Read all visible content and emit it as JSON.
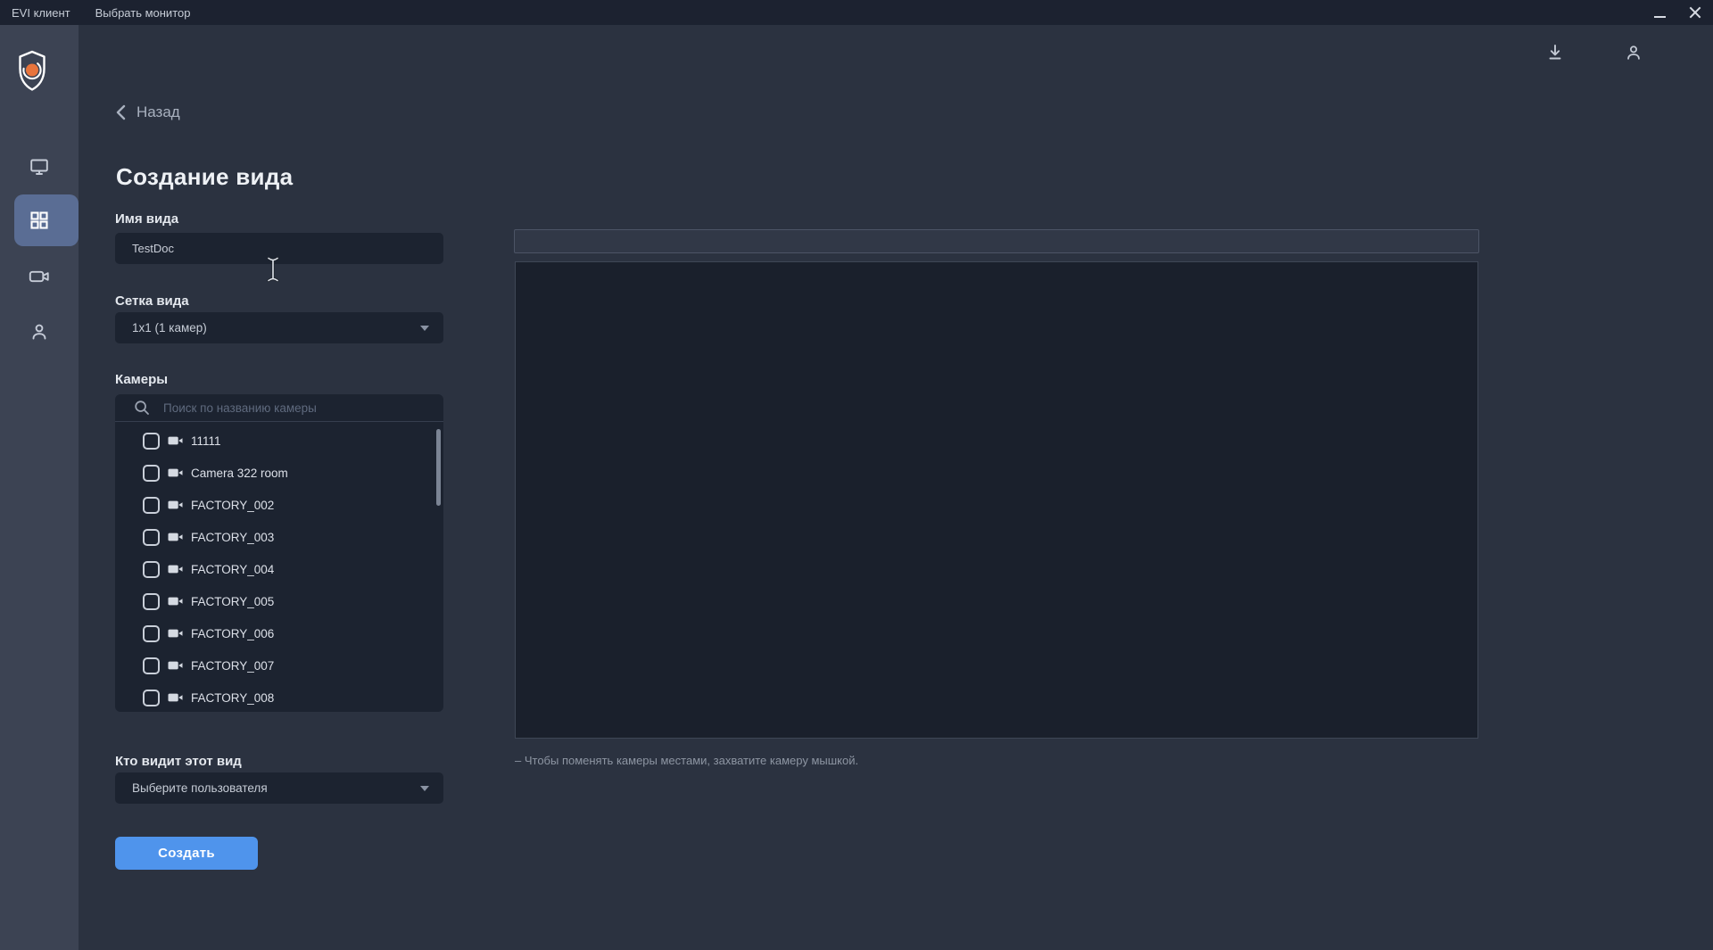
{
  "titlebar": {
    "app_menu": "EVI клиент",
    "monitor_menu": "Выбрать монитор"
  },
  "window_controls": {
    "minimize": "minimize",
    "close": "close"
  },
  "sidebar": {
    "items": [
      {
        "id": "monitors",
        "icon": "monitor-icon",
        "selected": false
      },
      {
        "id": "views",
        "icon": "grid-icon",
        "selected": true
      },
      {
        "id": "cameras",
        "icon": "videocam-icon",
        "selected": false
      },
      {
        "id": "users",
        "icon": "person-icon",
        "selected": false
      }
    ]
  },
  "header": {
    "back_label": "Назад",
    "icons": [
      "download-icon",
      "person-icon"
    ]
  },
  "page": {
    "title": "Создание вида"
  },
  "form": {
    "name": {
      "label": "Имя вида",
      "value": "TestDoc"
    },
    "grid": {
      "label": "Сетка вида",
      "value": "1x1 (1 камер)"
    },
    "cameras": {
      "label": "Камеры",
      "search_placeholder": "Поиск по названию камеры",
      "items": [
        {
          "label": "11111",
          "checked": false
        },
        {
          "label": "Camera 322 room",
          "checked": false
        },
        {
          "label": "FACTORY_002",
          "checked": false
        },
        {
          "label": "FACTORY_003",
          "checked": false
        },
        {
          "label": "FACTORY_004",
          "checked": false
        },
        {
          "label": "FACTORY_005",
          "checked": false
        },
        {
          "label": "FACTORY_006",
          "checked": false
        },
        {
          "label": "FACTORY_007",
          "checked": false
        },
        {
          "label": "FACTORY_008",
          "checked": false
        }
      ]
    },
    "visibility": {
      "label": "Кто видит этот вид",
      "value": "Выберите пользователя"
    },
    "submit_label": "Создать"
  },
  "preview": {
    "hint": "– Чтобы поменять камеры местами, захватите камеру мышкой."
  },
  "colors": {
    "accent_blue": "#4f94ec",
    "sidebar_selected": "#5a6d94",
    "logo_orange": "#e8743c",
    "background": "#2b3240",
    "panel": "#1c2330",
    "titlebar": "#1c2230",
    "sidebar": "#3c4353"
  }
}
